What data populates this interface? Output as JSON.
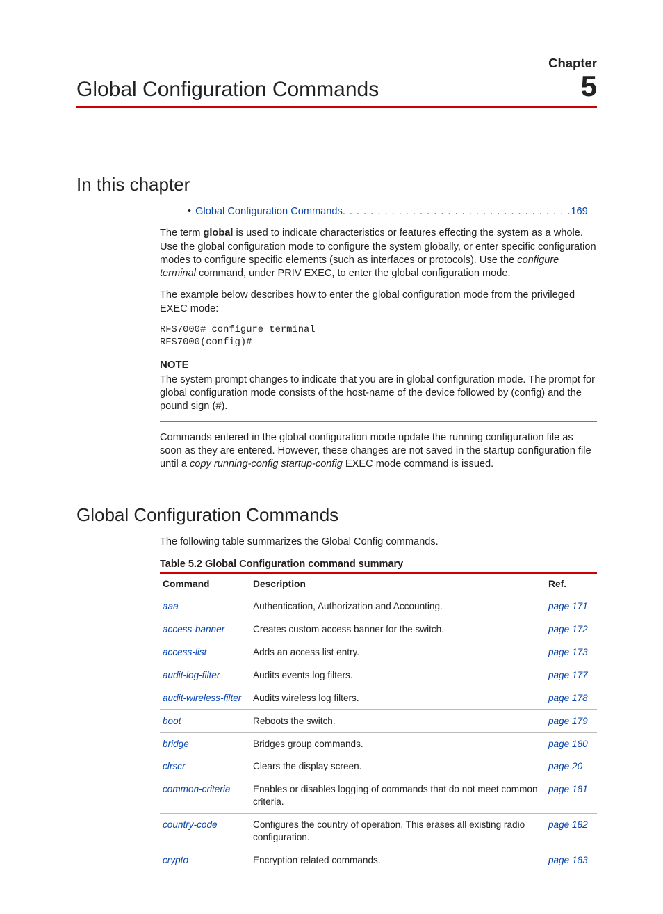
{
  "chapter": {
    "label": "Chapter",
    "number": "5",
    "title": "Global Configuration Commands"
  },
  "section_in_this": "In this chapter",
  "toc": {
    "label": "Global Configuration Commands",
    "dots": " . . . . . . . . . . . . . . . . . . . . . . . . . . . . . . . . .  ",
    "page": "169"
  },
  "para1_a": "The term ",
  "para1_b": "global",
  "para1_c": " is used to indicate characteristics or features effecting the system as a whole. Use the global configuration mode to configure the system globally, or enter specific configuration modes to configure specific elements (such as interfaces or protocols). Use the ",
  "para1_d": "configure terminal",
  "para1_e": " command, under PRIV EXEC, to enter the global configuration mode.",
  "para2": "The example below describes how to enter the global configuration mode from the privileged EXEC mode:",
  "code": "RFS7000# configure terminal\nRFS7000(config)#",
  "note_title": "NOTE",
  "note_body": "The system prompt changes to indicate that you are in global configuration mode. The prompt for global configuration mode consists of the host-name of the device followed by (config) and the pound sign (#).",
  "para3_a": "Commands entered in the global configuration mode update the running configuration file as soon as they are entered. However, these changes are not saved in the startup configuration file until a ",
  "para3_b": "copy running-config startup-config",
  "para3_c": " EXEC mode command is issued.",
  "section_gcc": "Global Configuration Commands",
  "para4": "The following table summarizes the Global Config commands.",
  "table_caption": "Table 5.2  Global Configuration command summary",
  "th": {
    "c1": "Command",
    "c2": "Description",
    "c3": "Ref."
  },
  "rows": [
    {
      "cmd": "aaa",
      "desc": "Authentication, Authorization and Accounting.",
      "ref": "page 171"
    },
    {
      "cmd": "access-banner",
      "desc": "Creates custom access banner for the switch.",
      "ref": "page 172"
    },
    {
      "cmd": "access-list",
      "desc": "Adds an access list entry.",
      "ref": "page 173"
    },
    {
      "cmd": "audit-log-filter",
      "desc": "Audits events log filters.",
      "ref": "page 177"
    },
    {
      "cmd": "audit-wireless-filter",
      "desc": "Audits wireless log filters.",
      "ref": "page 178"
    },
    {
      "cmd": "boot",
      "desc": "Reboots the switch.",
      "ref": "page 179"
    },
    {
      "cmd": "bridge",
      "desc": "Bridges group commands.",
      "ref": "page 180"
    },
    {
      "cmd": "clrscr",
      "desc": "Clears the display screen.",
      "ref": "page 20"
    },
    {
      "cmd": "common-criteria",
      "desc": "Enables or disables logging of commands that do not meet common criteria.",
      "ref": "page 181"
    },
    {
      "cmd": "country-code",
      "desc": "Configures the country of operation. This erases all existing radio configuration.",
      "ref": "page 182"
    },
    {
      "cmd": "crypto",
      "desc": "Encryption related commands.",
      "ref": "page 183"
    }
  ]
}
